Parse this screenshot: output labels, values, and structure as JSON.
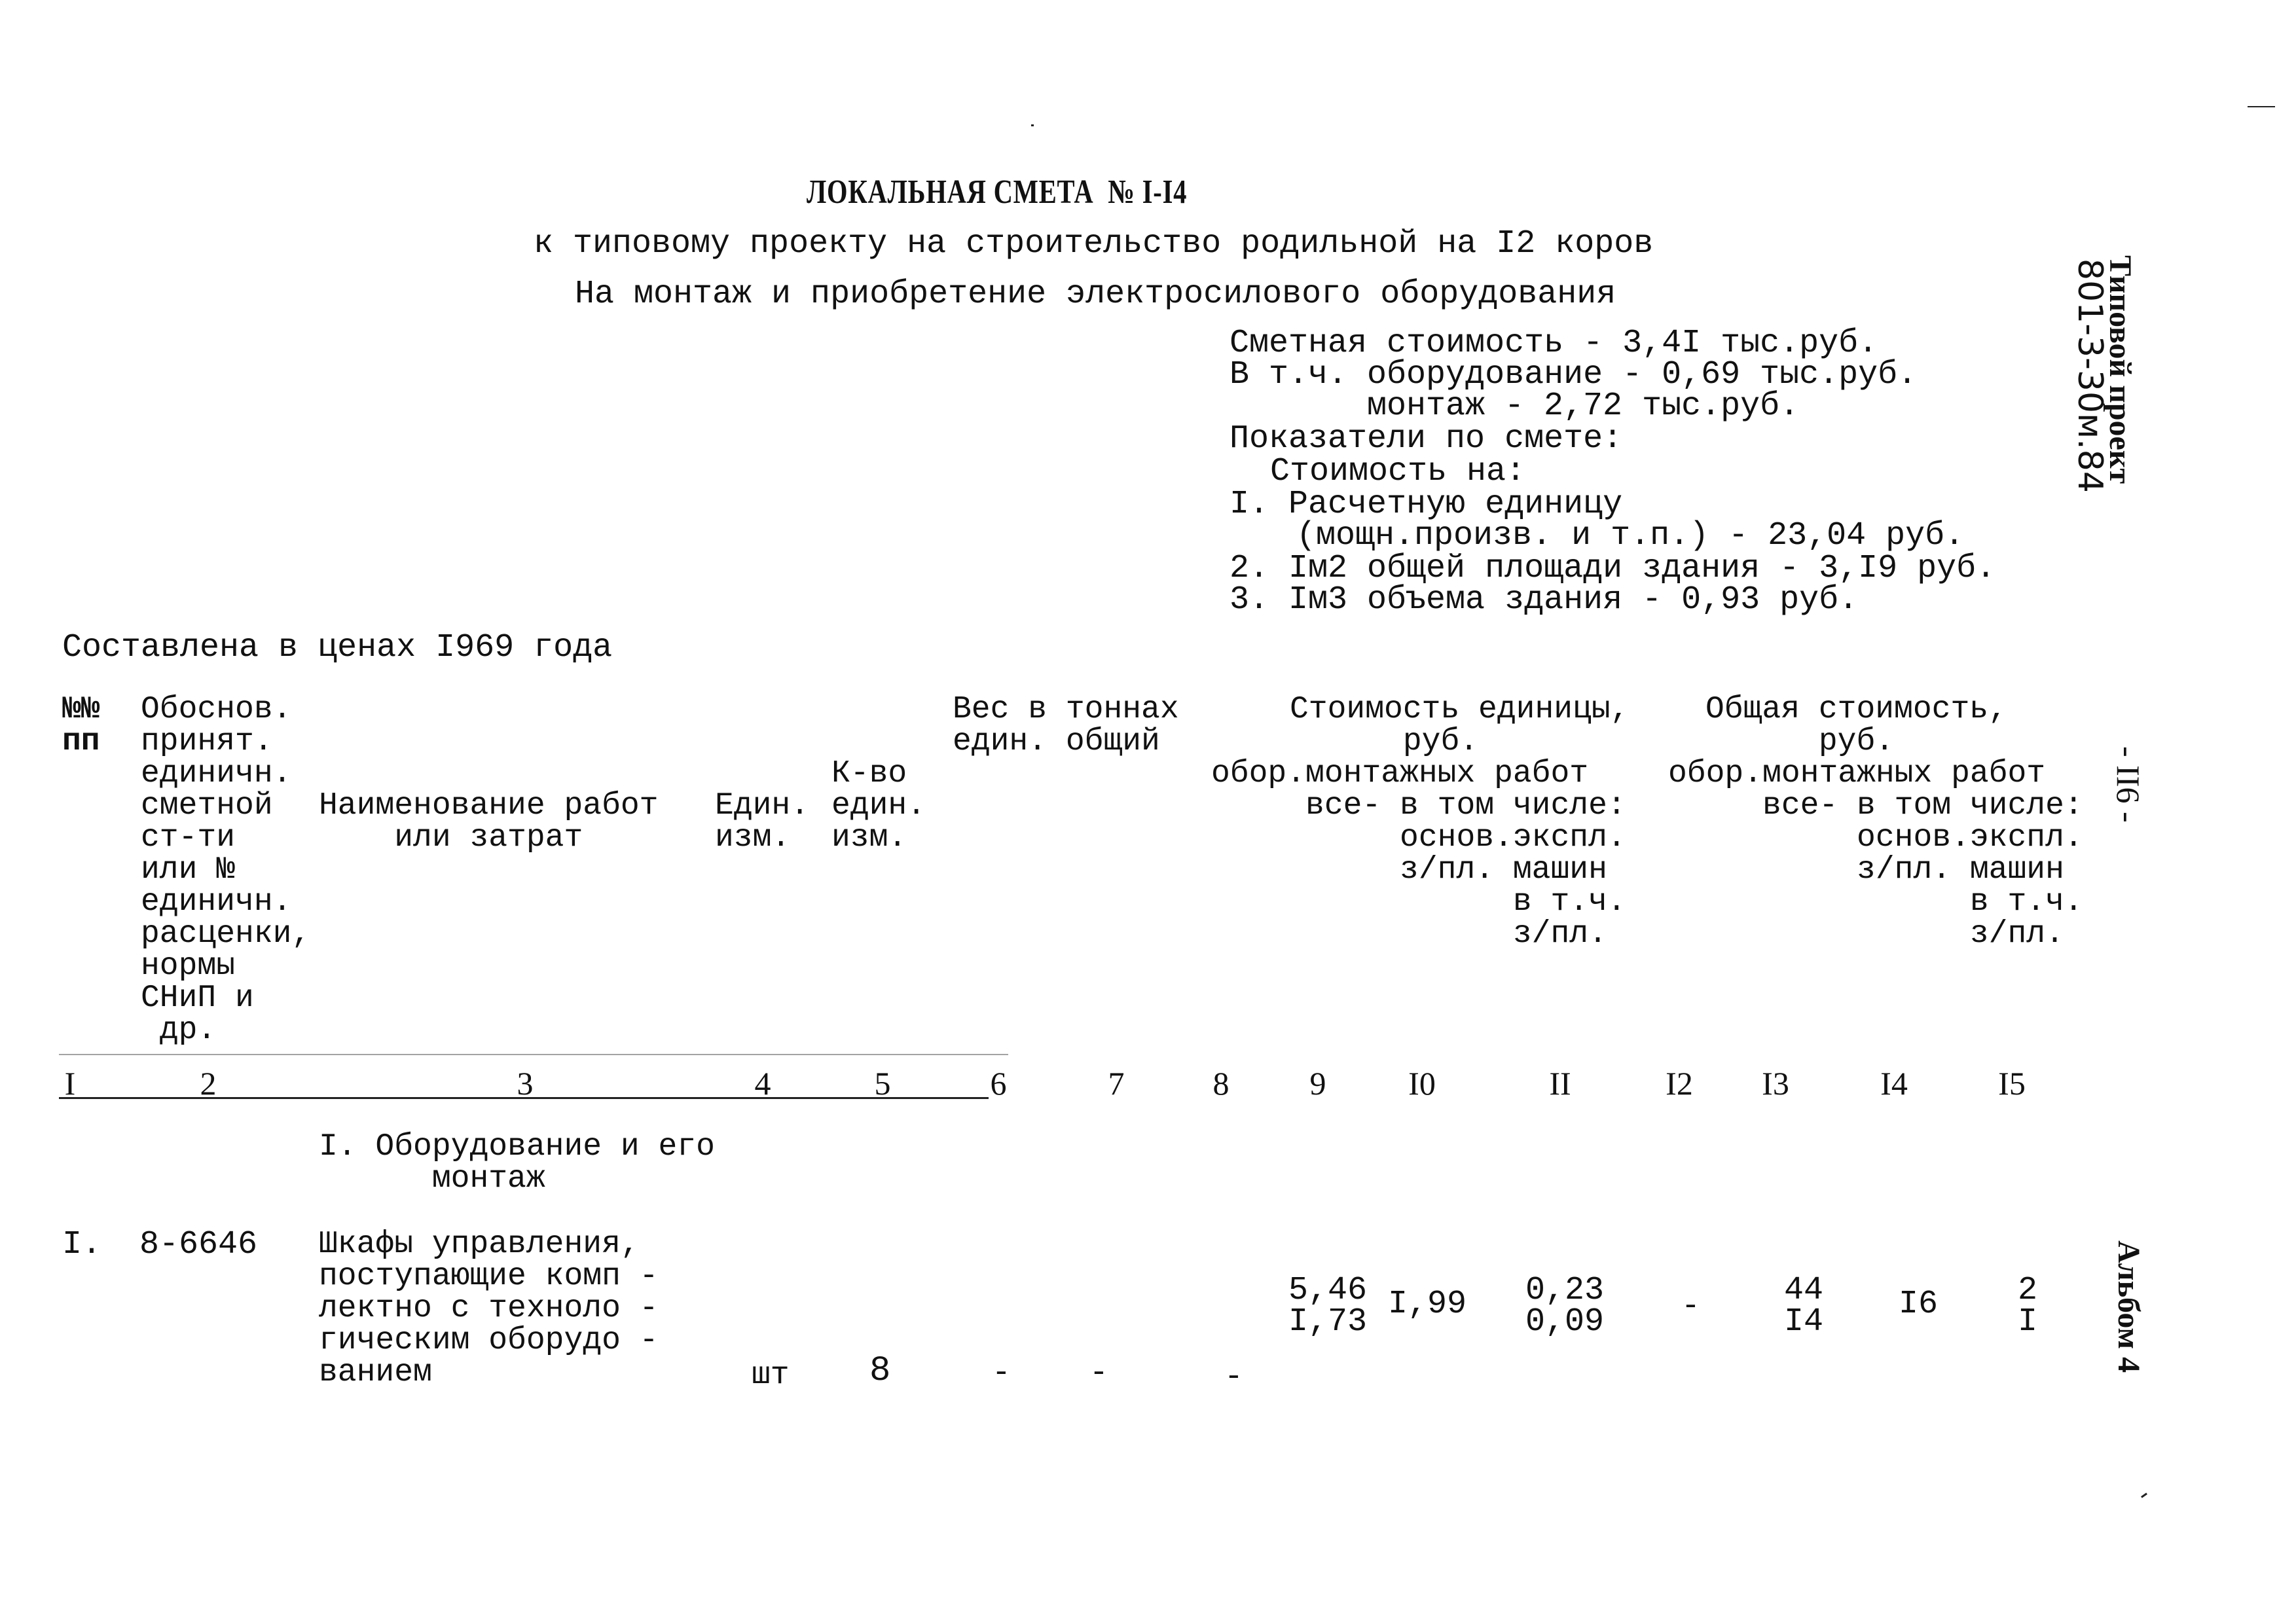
{
  "document": {
    "title": "ЛОКАЛЬНАЯ СМЕТА  № I-I4",
    "subtitle_1": "к типовому проекту на строительство родильной на I2 коров",
    "subtitle_2": "На монтаж и приобретение электросилового оборудования",
    "summary": {
      "line_1": "Сметная стоимость - 3,4I тыс.руб.",
      "line_2": "В т.ч. оборудование - 0,69 тыс.руб.",
      "line_3": "монтаж - 2,72 тыс.руб.",
      "line_4": "Показатели по смете:",
      "line_5": "Стоимость на:",
      "line_6": "I. Расчетную единицу",
      "line_7": "(мощн.произв. и т.п.) - 23,04 руб.",
      "line_8": "2. Iм2 общей площади здания - 3,I9 руб.",
      "line_9": "3. Iм3 объема здания - 0,93 руб."
    },
    "side_stamp": {
      "line_1": "Типовой проект",
      "line_2": "801-3-30м.84"
    },
    "page_number": "- II6 -",
    "album": "Альбом 4",
    "prices_note": "Составлена в ценах I969 года"
  },
  "table": {
    "headers": {
      "col1": "№№\nпп",
      "col2": "Обоснов.\nпринят.\nединичн.\nсметной\nст-ти\nили №\nединичн.\nрасценки,\nнормы\nСНиП и\n др.",
      "col3": "Наименование работ\n    или затрат",
      "col4": "Един.\nизм.",
      "col5": "К-во\nедин.\nизм.",
      "weight_group": "Вес в тоннах\nедин. общий",
      "unit_cost_group": "Стоимость единицы,\n      руб.",
      "unit_cost_sub": "обор.монтажных работ\n     все- в том числе:\n          основ.экспл.\n          з/пл. машин\n                в т.ч.\n                з/пл.",
      "total_cost_group": "Общая стоимость,\n      руб.",
      "total_cost_sub": "обор.монтажных работ\n     все- в том числе:\n          основ.экспл.\n          з/пл. машин\n                в т.ч.\n                з/пл."
    },
    "column_numbers": [
      "I",
      "2",
      "3",
      "4",
      "5",
      "6",
      "7",
      "8",
      "9",
      "I0",
      "II",
      "I2",
      "I3",
      "I4",
      "I5"
    ],
    "section_title": "I. Оборудование и его\n      монтаж",
    "rows": [
      {
        "num": "I.",
        "code": "8-6646",
        "name": "Шкафы управления,\nпоступающие комп -\nлектно с техноло -\nгическим оборудо -\nванием",
        "unit": "шт",
        "qty": "8",
        "weight_unit": "-",
        "weight_total": "-",
        "unit_equip": "-",
        "unit_mount_total": "5,46\nI,73",
        "unit_mount_basic_wage": "I,99",
        "unit_machines": "0,23\n0,09",
        "total_equip": "-",
        "total_mount_total": "44\nI4",
        "total_basic_wage": "I6",
        "total_machines": "2\nI"
      }
    ]
  }
}
